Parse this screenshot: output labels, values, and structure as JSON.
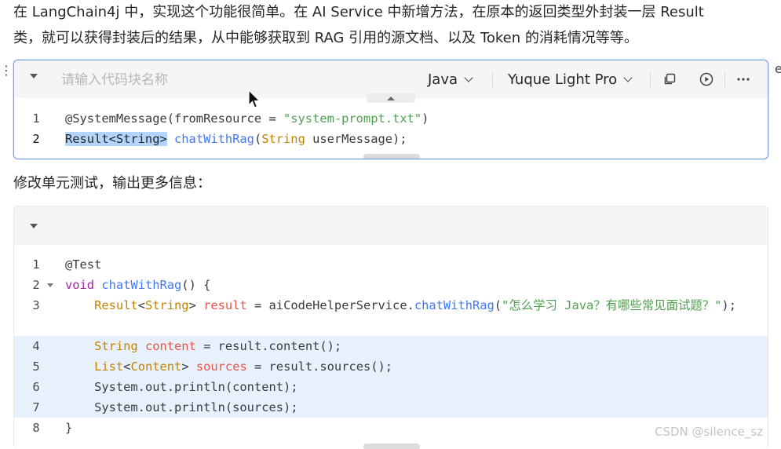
{
  "paragraphs": {
    "intro_line1": "在 LangChain4j 中，实现这个功能很简单。在 AI Service 中新增方法，在原本的返回类型外封装一层 Result",
    "intro_line2": "类，就可以获得封装后的结果，从中能够获取到 RAG 引用的源文档、以及 Token 的消耗情况等等。",
    "second": "修改单元测试，输出更多信息："
  },
  "code_block_1": {
    "name_placeholder": "请输入代码块名称",
    "language": "Java",
    "theme": "Yuque Light Pro",
    "lines": [
      {
        "number": "1",
        "tokens": [
          [
            "c-anno",
            "@SystemMessage"
          ],
          [
            "c-plain",
            "(fromResource = "
          ],
          [
            "c-str",
            "\"system-prompt.txt\""
          ],
          [
            "c-plain",
            ")"
          ]
        ]
      },
      {
        "number": "2",
        "tokens": [
          [
            "sel",
            "Result<String>"
          ],
          [
            "c-plain",
            " "
          ],
          [
            "c-fn",
            "chatWithRag"
          ],
          [
            "c-plain",
            "("
          ],
          [
            "c-type",
            "String"
          ],
          [
            "c-plain",
            " userMessage);"
          ]
        ]
      }
    ]
  },
  "code_block_2": {
    "lines": [
      {
        "number": "1",
        "tokens": [
          [
            "c-anno",
            "@Test"
          ]
        ]
      },
      {
        "number": "2",
        "fold": true,
        "tokens": [
          [
            "c-kw",
            "void"
          ],
          [
            "c-plain",
            " "
          ],
          [
            "c-fn",
            "chatWithRag"
          ],
          [
            "c-plain",
            "() {"
          ]
        ]
      },
      {
        "number": "3",
        "wrap": true,
        "tokens": [
          [
            "c-plain",
            "    "
          ],
          [
            "c-type",
            "Result"
          ],
          [
            "c-plain",
            "<"
          ],
          [
            "c-type",
            "String"
          ],
          [
            "c-plain",
            "> "
          ],
          [
            "c-var",
            "result"
          ],
          [
            "c-plain",
            " = aiCodeHelperService."
          ],
          [
            "c-fn",
            "chatWithRag"
          ],
          [
            "c-plain",
            "("
          ],
          [
            "c-str",
            "\"怎么学习 Java？有哪些常见面试题？\""
          ],
          [
            "c-plain",
            ");"
          ]
        ]
      },
      {
        "number": "4",
        "hl": true,
        "tokens": [
          [
            "c-plain",
            "    "
          ],
          [
            "c-type",
            "String"
          ],
          [
            "c-plain",
            " "
          ],
          [
            "c-var",
            "content"
          ],
          [
            "c-plain",
            " = result.content();"
          ]
        ]
      },
      {
        "number": "5",
        "hl": true,
        "tokens": [
          [
            "c-plain",
            "    "
          ],
          [
            "c-type",
            "List"
          ],
          [
            "c-plain",
            "<"
          ],
          [
            "c-type",
            "Content"
          ],
          [
            "c-plain",
            "> "
          ],
          [
            "c-var",
            "sources"
          ],
          [
            "c-plain",
            " = result.sources();"
          ]
        ]
      },
      {
        "number": "6",
        "hl": true,
        "tokens": [
          [
            "c-plain",
            "    System.out.println(content);"
          ]
        ]
      },
      {
        "number": "7",
        "hl": true,
        "tokens": [
          [
            "c-plain",
            "    System.out.println(sources);"
          ]
        ]
      },
      {
        "number": "8",
        "tokens": [
          [
            "c-plain",
            "}"
          ]
        ]
      }
    ]
  },
  "watermark": "CSDN @silence_sz",
  "icons": {
    "collapse": "caret-down-icon",
    "copy": "copy-icon",
    "run": "play-circle-icon",
    "more": "more-horizontal-icon",
    "expand": "caret-up-icon",
    "drag_handle": "drag-handle-icon"
  },
  "colors": {
    "accent_border": "#79a3e0",
    "selection": "#b3d4fc",
    "highlight_line": "#e8f1fb"
  }
}
